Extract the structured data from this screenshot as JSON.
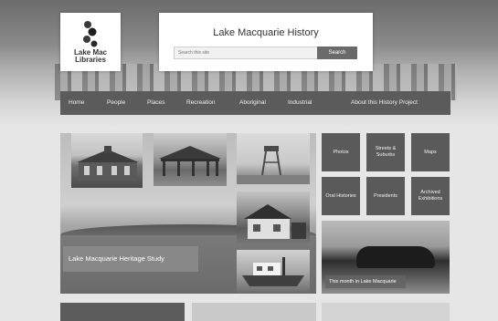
{
  "header": {
    "logo_text_line1": "Lake Mac",
    "logo_text_line2": "Libraries",
    "site_title": "Lake Macquarie History",
    "search_placeholder": "Search this site",
    "search_button": "Search"
  },
  "nav": {
    "items": [
      "Home",
      "People",
      "Places",
      "Recreation",
      "Aboriginal",
      "Industrial",
      "About this History Project"
    ]
  },
  "hero": {
    "caption": "Lake Macquarie Heritage Study"
  },
  "tiles": [
    {
      "label": "Photos"
    },
    {
      "label": "Streets & Suburbs"
    },
    {
      "label": "Maps"
    },
    {
      "label": "Oral Histories"
    },
    {
      "label": "Presidents"
    },
    {
      "label": "Archived Exhibitions"
    }
  ],
  "feature": {
    "caption": "This month in Lake Macquarie"
  }
}
